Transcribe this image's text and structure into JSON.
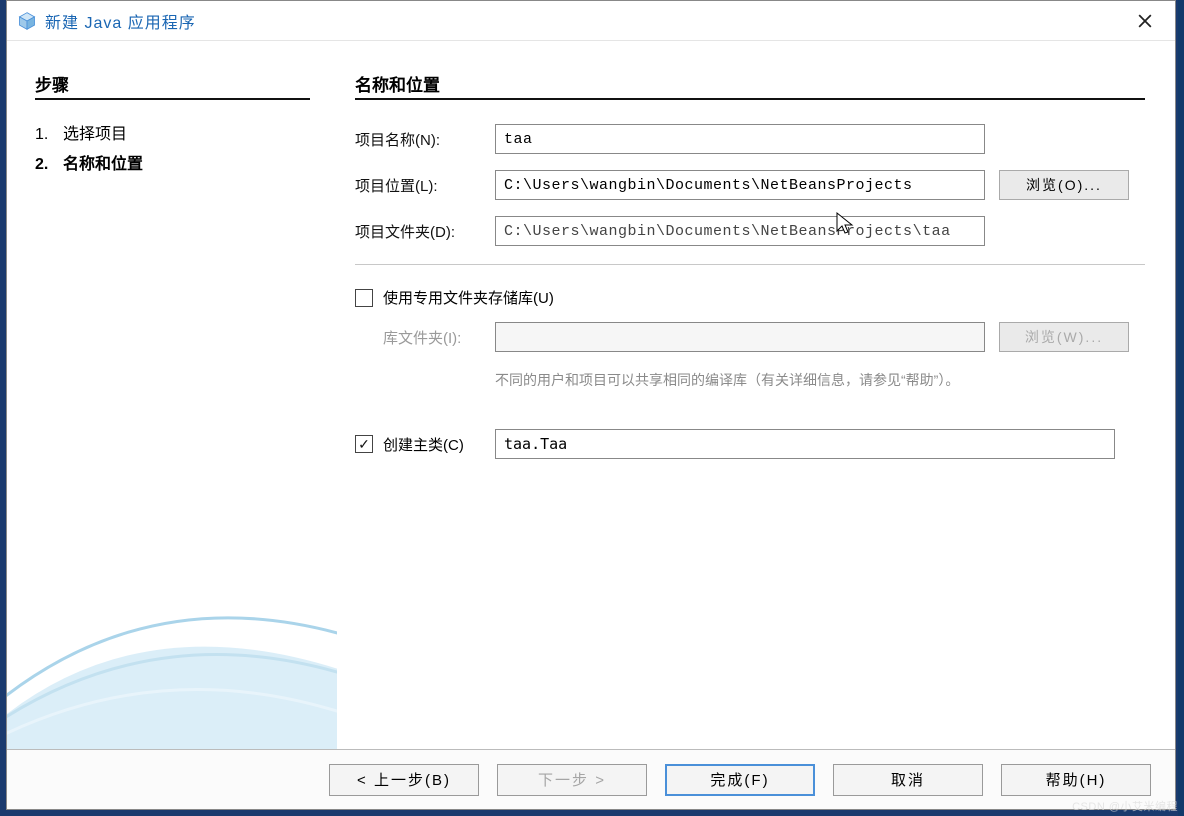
{
  "titlebar": {
    "title": "新建 Java 应用程序",
    "close_tooltip": "关闭"
  },
  "sidebar": {
    "heading": "步骤",
    "steps": [
      {
        "num": "1.",
        "label": "选择项目",
        "current": false
      },
      {
        "num": "2.",
        "label": "名称和位置",
        "current": true
      }
    ]
  },
  "main": {
    "heading": "名称和位置",
    "project_name_label": "项目名称(N):",
    "project_name_value": "taa",
    "project_location_label": "项目位置(L):",
    "project_location_value": "C:\\Users\\wangbin\\Documents\\NetBeansProjects",
    "project_folder_label": "项目文件夹(D):",
    "project_folder_value": "C:\\Users\\wangbin\\Documents\\NetBeansProjects\\taa",
    "browse_label": "浏览(O)...",
    "use_dedicated_label": "使用专用文件夹存储库(U)",
    "use_dedicated_checked": false,
    "lib_folder_label": "库文件夹(I):",
    "lib_folder_value": "",
    "browse2_label": "浏览(W)...",
    "hint_line": "不同的用户和项目可以共享相同的编译库（有关详细信息，请参见“帮助”）。",
    "create_main_label": "创建主类(C)",
    "create_main_checked": true,
    "create_main_value": "taa.Taa"
  },
  "footer": {
    "back": "< 上一步(B)",
    "next": "下一步 >",
    "finish": "完成(F)",
    "cancel": "取消",
    "help": "帮助(H)"
  },
  "watermark": "CSDN @小艾米编程"
}
